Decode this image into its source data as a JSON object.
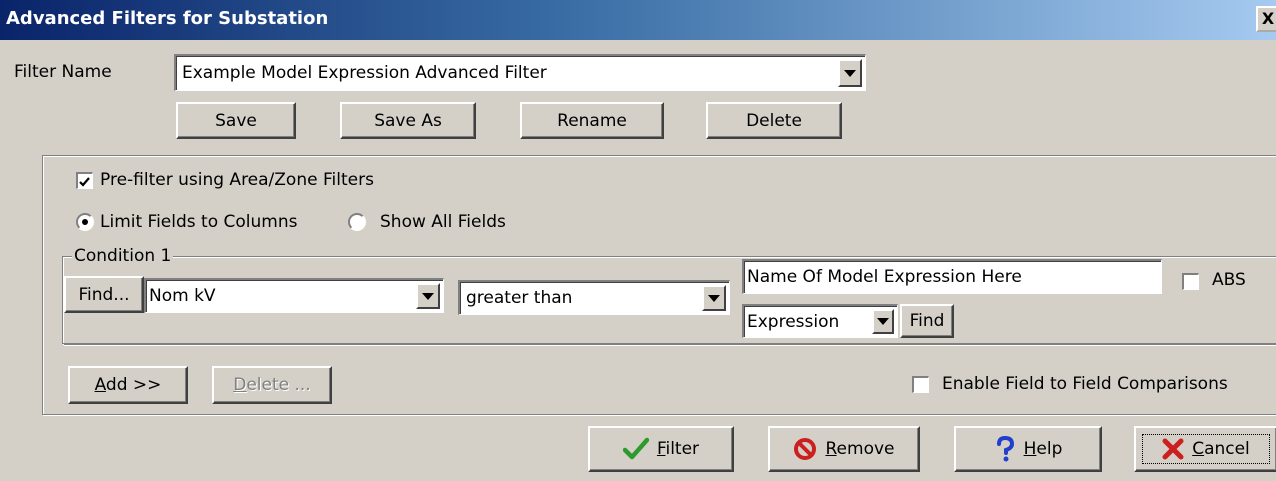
{
  "window": {
    "title": "Advanced Filters for Substation",
    "close_glyph": "X"
  },
  "filter": {
    "name_label": "Filter Name",
    "name_value": "Example Model Expression Advanced Filter"
  },
  "filter_buttons": {
    "save": "Save",
    "save_as": "Save As",
    "rename": "Rename",
    "delete": "Delete"
  },
  "options": {
    "prefilter_label": "Pre-filter using Area/Zone Filters",
    "prefilter_checked": true,
    "limit_fields_label": "Limit Fields to Columns",
    "show_all_fields_label": "Show All Fields",
    "selected_field_mode": "Limit Fields to Columns"
  },
  "condition": {
    "title": "Condition 1",
    "find_label": "Find...",
    "field_value": "Nom kV",
    "operator_value": "greater than",
    "value_text": "Name Of Model Expression Here",
    "abs_label": "ABS",
    "abs_checked": false,
    "type_value": "Expression",
    "type_find_label": "Find"
  },
  "condition_buttons": {
    "add_key": "A",
    "add_rest": "dd >>",
    "delete_key": "D",
    "delete_rest": "elete ..."
  },
  "enable_field_compare": {
    "label": "Enable Field to Field Comparisons",
    "checked": false
  },
  "footer": {
    "filter_key": "F",
    "filter_rest": "ilter",
    "remove_key": "R",
    "remove_rest": "emove",
    "help_key": "H",
    "help_rest": "elp",
    "cancel_key": "C",
    "cancel_rest": "ancel"
  },
  "icons": {
    "filter": "checkmark-icon",
    "remove": "no-entry-icon",
    "help": "question-icon",
    "cancel": "x-icon",
    "accent_green": "#2e9a2e",
    "accent_red": "#cc1f1f",
    "accent_blue": "#1f3fcc"
  }
}
